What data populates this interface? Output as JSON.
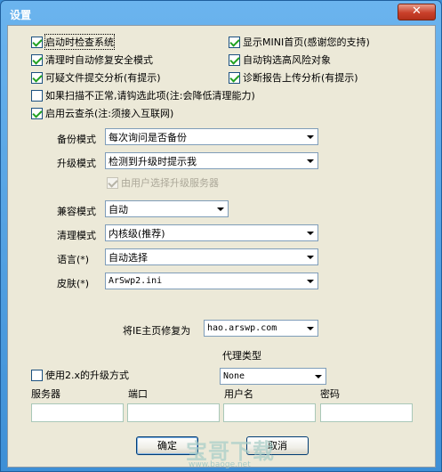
{
  "window": {
    "title": "设置",
    "close_glyph": "✕"
  },
  "checkboxes": [
    {
      "label": "启动时检查系统",
      "checked": true
    },
    {
      "label": "显示MINI首页(感谢您的支持)",
      "checked": true
    },
    {
      "label": "清理时自动修复安全模式",
      "checked": true
    },
    {
      "label": "自动钩选高风险对象",
      "checked": true
    },
    {
      "label": "可疑文件提交分析(有提示)",
      "checked": true
    },
    {
      "label": "诊断报告上传分析(有提示)",
      "checked": true
    },
    {
      "label": "如果扫描不正常,请钩选此项(注:会降低清理能力)",
      "checked": false
    },
    {
      "label": "启用云查杀(注:须接入互联网)",
      "checked": true
    }
  ],
  "backup": {
    "label": "备份模式",
    "value": "每次询问是否备份"
  },
  "upgrade": {
    "label": "升级模式",
    "value": "检测到升级时提示我"
  },
  "server_choice": {
    "label": "由用户选择升级服务器",
    "checked": true
  },
  "compat": {
    "label": "兼容模式",
    "value": "自动"
  },
  "clean": {
    "label": "清理模式",
    "value": "内核级(推荐)"
  },
  "language": {
    "label": "语言(*)",
    "value": "自动选择"
  },
  "skin": {
    "label": "皮肤(*)",
    "value": "ArSwp2.ini"
  },
  "homepage": {
    "label": "将IE主页修复为",
    "value": "hao.arswp.com"
  },
  "proxy": {
    "type_label": "代理类型",
    "type_value": "None",
    "use_v2_label": "使用2.x的升级方式",
    "use_v2_checked": false,
    "server_label": "服务器",
    "port_label": "端口",
    "user_label": "用户名",
    "password_label": "密码",
    "server_value": "",
    "port_value": "",
    "user_value": "",
    "password_value": ""
  },
  "buttons": {
    "ok": "确定",
    "cancel": "取消"
  },
  "watermark": {
    "text": "宝哥下载",
    "url": "www.baoge.net"
  }
}
